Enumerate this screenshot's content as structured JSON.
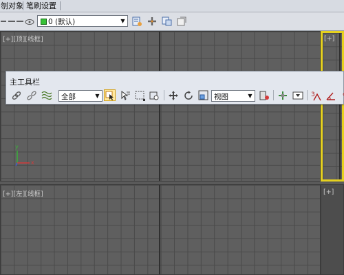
{
  "menubar": {
    "items": [
      {
        "label": "刎对象"
      },
      {
        "label": "笔刷设置"
      }
    ]
  },
  "layer_toolbar": {
    "layer_value": "0 (默认)",
    "icons": [
      "dash-icon",
      "dash-icon",
      "eye-hide-icon",
      "new-layer-icon",
      "add-to-layer-icon",
      "select-in-layer-icon",
      "set-current-layer-icon"
    ]
  },
  "viewports": {
    "top_left": {
      "label": "[+][顶][线框]"
    },
    "bottom_left": {
      "label": "[+][左][线框]"
    },
    "top_right": {
      "label": "[+]",
      "active": true
    },
    "bottom_right": {
      "label": "[+]"
    }
  },
  "gizmo": {
    "y_label": "y",
    "x_label": "x",
    "x_color": "#d43a3a",
    "y_color": "#3ab03a",
    "z_color": "#4060d0"
  },
  "main_toolbar": {
    "title": "主工具栏",
    "selection_filter": "全部",
    "reference_coordinate": "视图",
    "icons": [
      "link-icon",
      "unlink-icon",
      "bind-space-warp-icon",
      "select-object-icon",
      "select-by-name-icon",
      "rect-selection-icon",
      "window-crossing-icon",
      "move-icon",
      "rotate-icon",
      "scale-icon",
      "pivot-center-icon",
      "manipulate-icon",
      "keyboard-shortcut-icon",
      "snaps-icon",
      "angle-snap-icon",
      "percent-snap-icon"
    ]
  },
  "colors": {
    "active_viewport_border": "#e6d11e",
    "grid_bg": "#5f5f5f",
    "toolbar_bg": "#e3e7ee"
  }
}
